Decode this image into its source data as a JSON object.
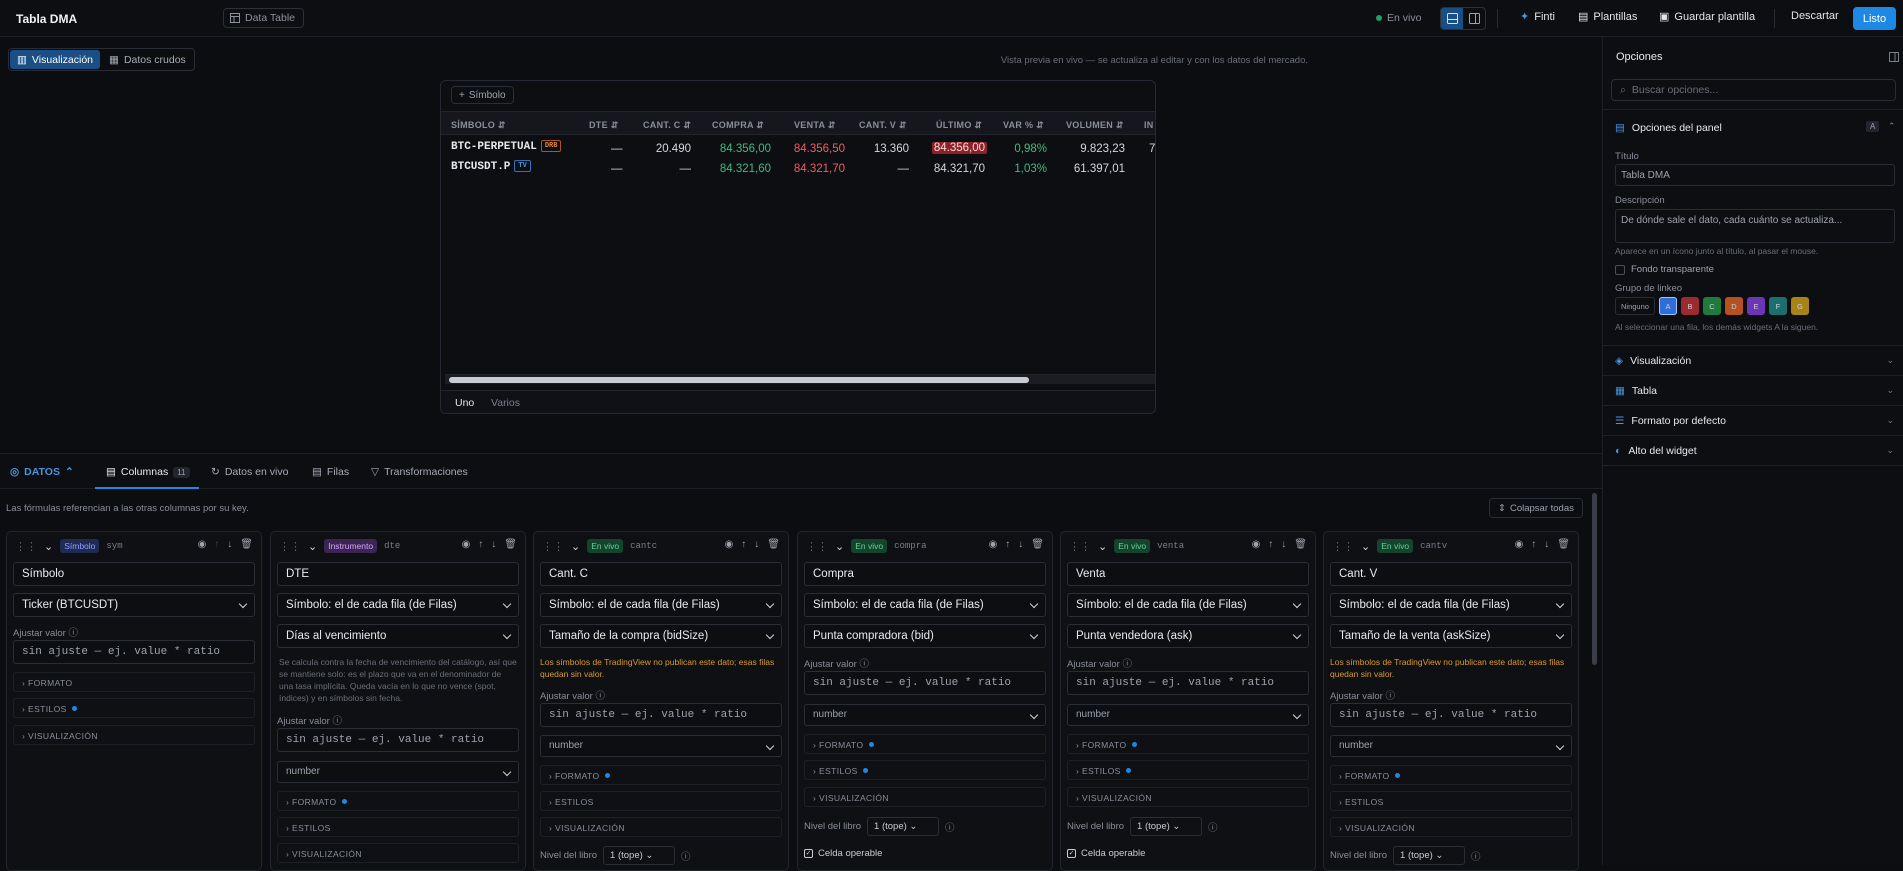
{
  "app": {
    "title": "Tabla DMA",
    "chip": "Data Table",
    "live": "En vivo"
  },
  "toolbar": {
    "finti": "Finti",
    "plantillas": "Plantillas",
    "guardar": "Guardar plantilla",
    "descartar": "Descartar",
    "listo": "Listo"
  },
  "view_tabs": {
    "vis": "Visualización",
    "raw": "Datos crudos"
  },
  "preview_hint": "Vista previa en vivo — se actualiza al editar y con los datos del mercado.",
  "widget": {
    "symbol_btn": "Símbolo",
    "headers": [
      "SÍMBOLO",
      "DTE",
      "CANT. C",
      "COMPRA",
      "VENTA",
      "CANT. V",
      "ÚLTIMO",
      "VAR %",
      "VOLUMEN",
      "IN"
    ],
    "rows": [
      {
        "sym": "BTC-PERPETUAL",
        "tag": "DRB",
        "dte": "—",
        "cantc": "20.490",
        "compra": "84.356,00",
        "venta": "84.356,50",
        "cantv": "13.360",
        "ultimo": "84.356,00",
        "var": "0,98%",
        "vol": "9.823,23",
        "in": "7"
      },
      {
        "sym": "BTCUSDT.P",
        "tag": "TV",
        "dte": "—",
        "cantc": "—",
        "compra": "84.321,60",
        "venta": "84.321,70",
        "cantv": "—",
        "ultimo": "84.321,70",
        "var": "1,03%",
        "vol": "61.397,01",
        "in": ""
      }
    ],
    "foot": {
      "uno": "Uno",
      "varios": "Varios"
    }
  },
  "opciones": {
    "title": "Opciones",
    "search_placeholder": "Buscar opciones...",
    "panel_title": "Opciones del panel",
    "panel_badge": "A",
    "titulo_label": "Título",
    "titulo_value": "Tabla DMA",
    "desc_label": "Descripción",
    "desc_placeholder": "De dónde sale el dato, cada cuánto se actualiza...",
    "desc_note": "Aparece en un ícono junto al título, al pasar el mouse.",
    "fondo": "Fondo transparente",
    "grupo_label": "Grupo de linkeo",
    "grupo_ninguno": "Ninguno",
    "grupos": [
      "A",
      "B",
      "C",
      "D",
      "E",
      "F",
      "G"
    ],
    "grupo_colors": [
      "#2d6fd6",
      "#9b2a31",
      "#1f7a3e",
      "#b5521f",
      "#6b35b5",
      "#1b6f6f",
      "#a88416"
    ],
    "grupo_note": "Al seleccionar una fila, los demás widgets A la siguen.",
    "sections": [
      "Visualización",
      "Tabla",
      "Formato por defecto",
      "Alto del widget"
    ]
  },
  "datos": {
    "label": "DATOS",
    "tabs": {
      "columnas": "Columnas",
      "columnas_count": "11",
      "vivo": "Datos en vivo",
      "filas": "Filas",
      "trans": "Transformaciones"
    },
    "note": "Las fórmulas referencian a las otras columnas por su key.",
    "collapse": "Colapsar todas"
  },
  "cards": [
    {
      "badge": "Símbolo",
      "key": "sym",
      "name": "Símbolo",
      "source": "Ticker (BTCUSDT)",
      "ajustar": "Ajustar valor",
      "formula": "sin ajuste — ej. value * ratio",
      "formato": "FORMATO",
      "estilos": "ESTILOS",
      "visual": "VISUALIZACIÓN"
    },
    {
      "badge": "Instrumento",
      "key": "dte",
      "name": "DTE",
      "source": "Símbolo: el de cada fila (de Filas)",
      "field": "Días al vencimiento",
      "desc": "Se calcula contra la fecha de vencimiento del catálogo, así que se mantiene solo: es el plazo que va en el denominador de una tasa implícita. Queda vacía en lo que no vence (spot, índices) y en símbolos sin fecha.",
      "ajustar": "Ajustar valor",
      "formula": "sin ajuste — ej. value * ratio",
      "number": "number",
      "formato": "FORMATO",
      "estilos": "ESTILOS",
      "visual": "VISUALIZACIÓN"
    },
    {
      "badge": "En vivo",
      "key": "cantc",
      "name": "Cant. C",
      "source": "Símbolo: el de cada fila (de Filas)",
      "field": "Tamaño de la compra (bidSize)",
      "warn": "Los símbolos de TradingView no publican este dato; esas filas quedan sin valor.",
      "ajustar": "Ajustar valor",
      "formula": "sin ajuste — ej. value * ratio",
      "number": "number",
      "formato": "FORMATO",
      "estilos": "ESTILOS",
      "visual": "VISUALIZACIÓN",
      "libro": "Nivel del libro",
      "libro_val": "1 (tope)"
    },
    {
      "badge": "En vivo",
      "key": "compra",
      "name": "Compra",
      "source": "Símbolo: el de cada fila (de Filas)",
      "field": "Punta compradora (bid)",
      "ajustar": "Ajustar valor",
      "formula": "sin ajuste — ej. value * ratio",
      "number": "number",
      "formato": "FORMATO",
      "estilos": "ESTILOS",
      "visual": "VISUALIZACIÓN",
      "libro": "Nivel del libro",
      "libro_val": "1 (tope)",
      "celda": "Celda operable"
    },
    {
      "badge": "En vivo",
      "key": "venta",
      "name": "Venta",
      "source": "Símbolo: el de cada fila (de Filas)",
      "field": "Punta vendedora (ask)",
      "ajustar": "Ajustar valor",
      "formula": "sin ajuste — ej. value * ratio",
      "number": "number",
      "formato": "FORMATO",
      "estilos": "ESTILOS",
      "visual": "VISUALIZACIÓN",
      "libro": "Nivel del libro",
      "libro_val": "1 (tope)",
      "celda": "Celda operable"
    },
    {
      "badge": "En vivo",
      "key": "cantv",
      "name": "Cant. V",
      "source": "Símbolo: el de cada fila (de Filas)",
      "field": "Tamaño de la venta (askSize)",
      "warn": "Los símbolos de TradingView no publican este dato; esas filas quedan sin valor.",
      "ajustar": "Ajustar valor",
      "formula": "sin ajuste — ej. value * ratio",
      "number": "number",
      "formato": "FORMATO",
      "estilos": "ESTILOS",
      "visual": "VISUALIZACIÓN",
      "libro": "Nivel del libro",
      "libro_val": "1 (tope)"
    }
  ]
}
